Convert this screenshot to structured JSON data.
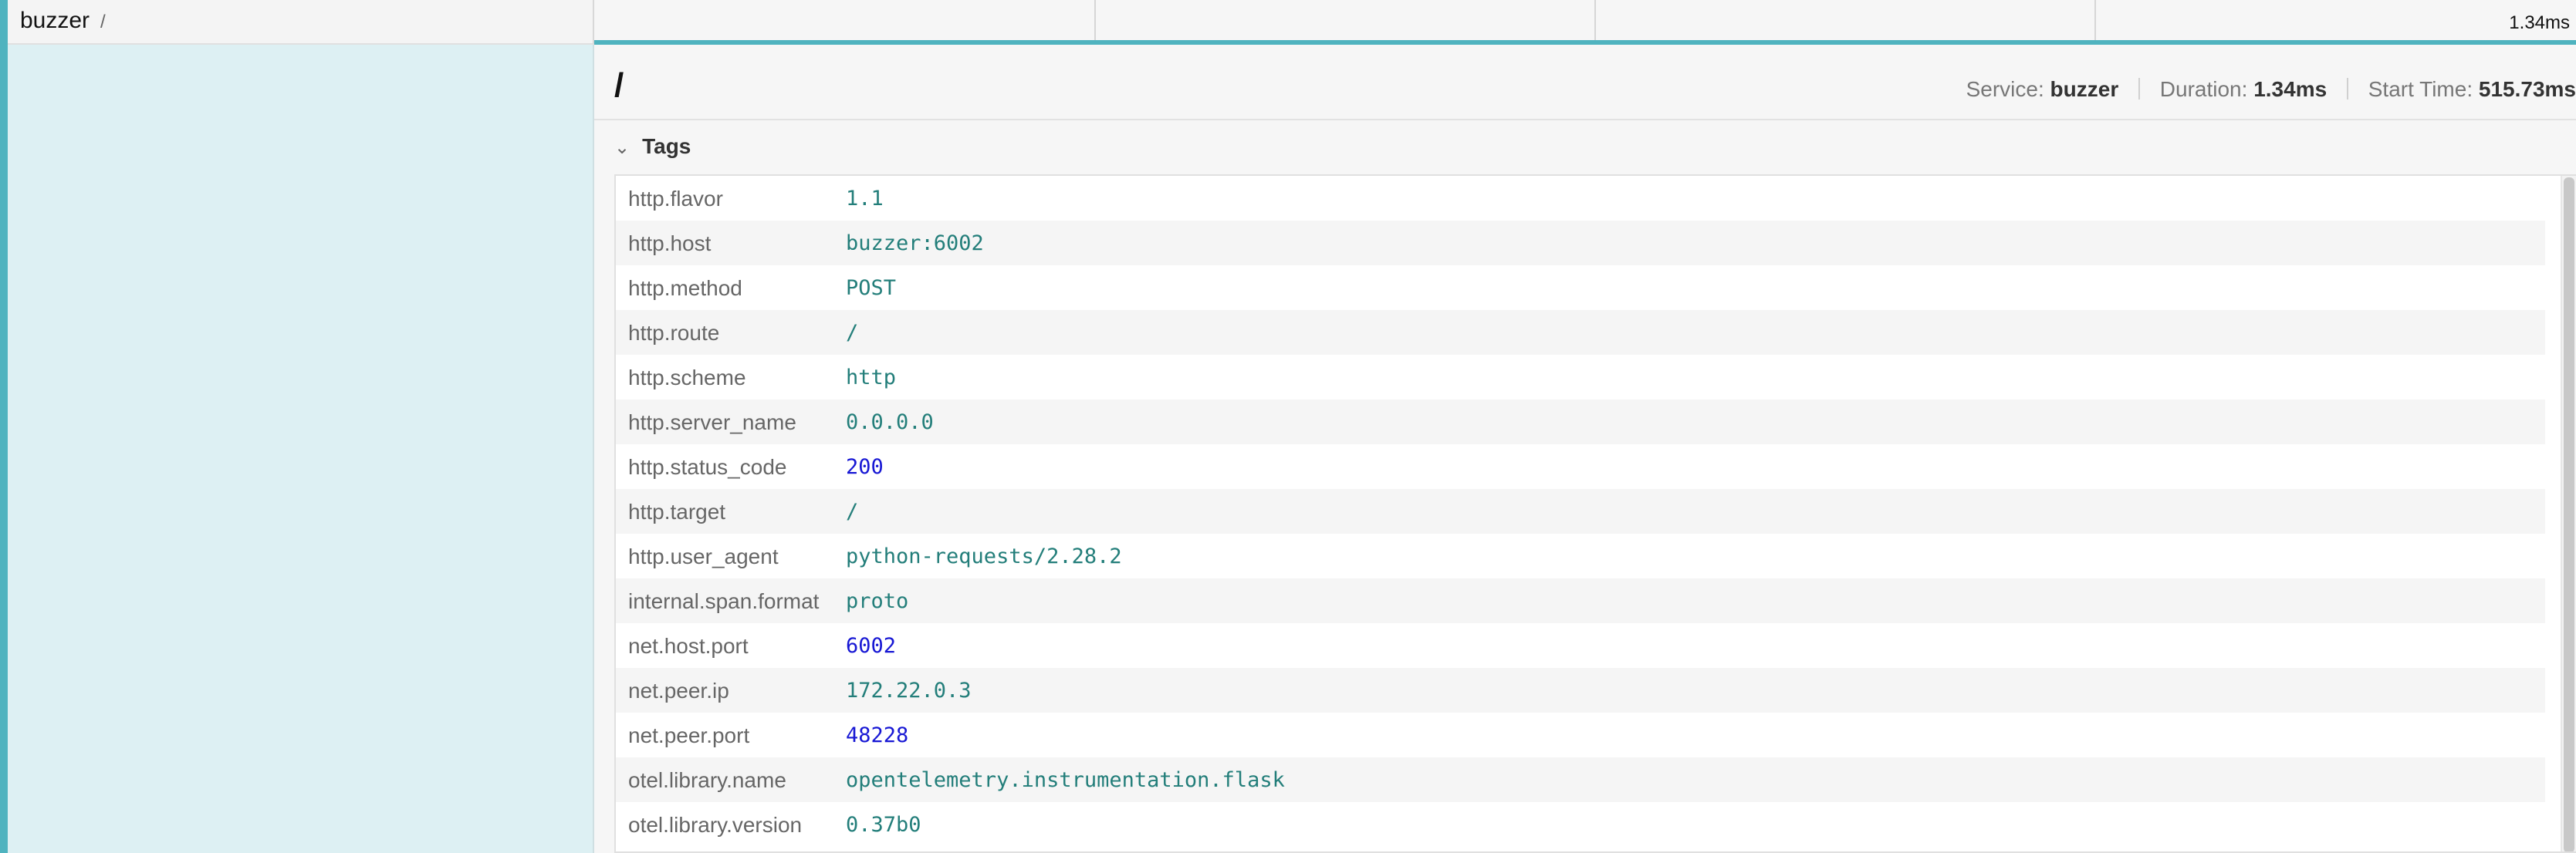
{
  "span": {
    "service": "buzzer",
    "operation": "/",
    "duration_label": "1.34ms"
  },
  "detail": {
    "title": "/",
    "service_label": "Service:",
    "service_value": "buzzer",
    "duration_label": "Duration:",
    "duration_value": "1.34ms",
    "start_label": "Start Time:",
    "start_value": "515.73ms"
  },
  "tags": {
    "header": "Tags",
    "rows": [
      {
        "key": "http.flavor",
        "value": "1.1",
        "numeric": false
      },
      {
        "key": "http.host",
        "value": "buzzer:6002",
        "numeric": false
      },
      {
        "key": "http.method",
        "value": "POST",
        "numeric": false
      },
      {
        "key": "http.route",
        "value": "/",
        "numeric": false
      },
      {
        "key": "http.scheme",
        "value": "http",
        "numeric": false
      },
      {
        "key": "http.server_name",
        "value": "0.0.0.0",
        "numeric": false
      },
      {
        "key": "http.status_code",
        "value": "200",
        "numeric": true
      },
      {
        "key": "http.target",
        "value": "/",
        "numeric": false
      },
      {
        "key": "http.user_agent",
        "value": "python-requests/2.28.2",
        "numeric": false
      },
      {
        "key": "internal.span.format",
        "value": "proto",
        "numeric": false
      },
      {
        "key": "net.host.port",
        "value": "6002",
        "numeric": true
      },
      {
        "key": "net.peer.ip",
        "value": "172.22.0.3",
        "numeric": false
      },
      {
        "key": "net.peer.port",
        "value": "48228",
        "numeric": true
      },
      {
        "key": "otel.library.name",
        "value": "opentelemetry.instrumentation.flask",
        "numeric": false
      },
      {
        "key": "otel.library.version",
        "value": "0.37b0",
        "numeric": false
      }
    ]
  },
  "colors": {
    "accent": "#4fb3bf",
    "string_value": "#237e7a",
    "number_value": "#1717d4",
    "selected_row_bg": "#ddf0f3"
  }
}
